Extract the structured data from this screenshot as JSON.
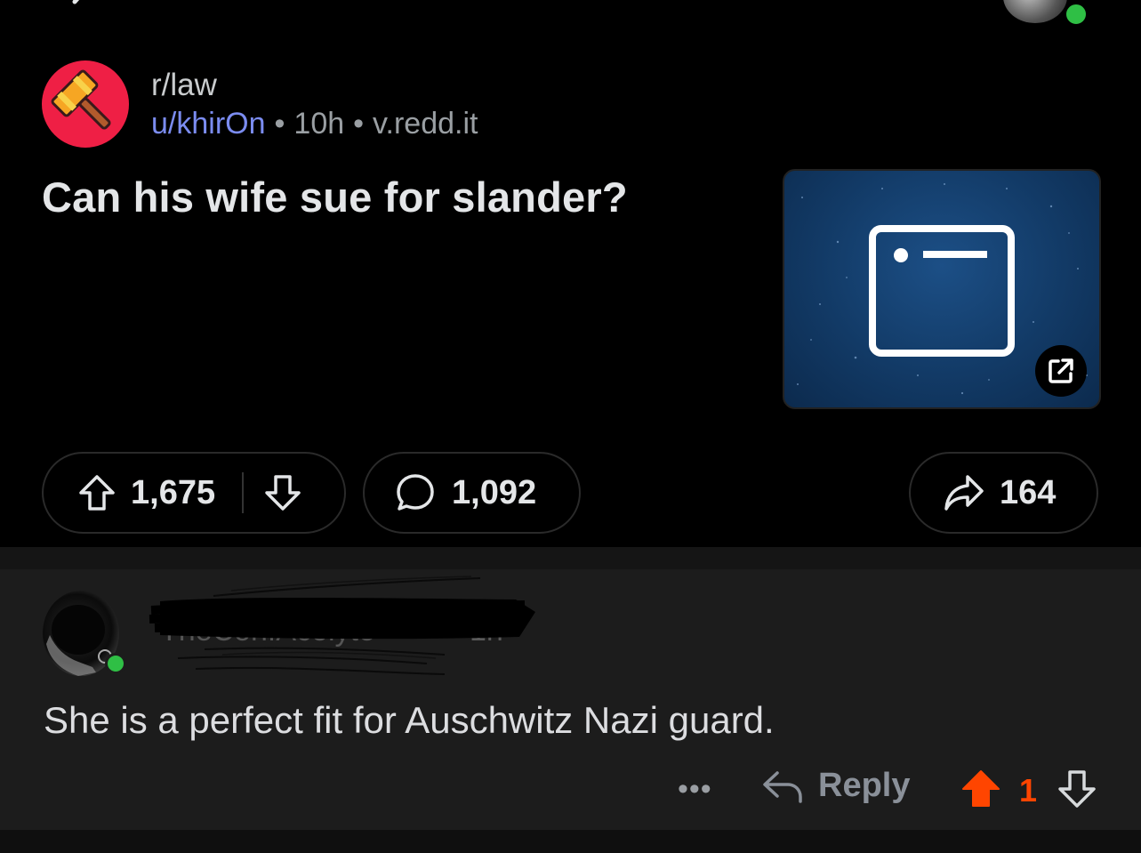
{
  "post": {
    "subreddit": "r/law",
    "author": "u/khirOn",
    "age": "10h",
    "domain": "v.redd.it",
    "title": "Can his wife sue for slander?",
    "upvotes": "1,675",
    "comments": "1,092",
    "shares": "164"
  },
  "comment": {
    "author": "TheConfAcolyte",
    "age": "1h",
    "body": "She is a perfect fit for Auschwitz Nazi guard.",
    "more_label": "•••",
    "reply_label": "Reply",
    "score": "1"
  },
  "icons": {
    "subreddit": "gavel-icon",
    "thumbnail": "browser-window-icon",
    "external": "external-link-icon",
    "upvote": "arrow-up-icon",
    "downvote": "arrow-down-icon",
    "comment": "speech-bubble-icon",
    "share": "share-arrow-icon",
    "reply": "reply-arrow-icon"
  },
  "colors": {
    "background": "#000000",
    "comment_background": "#1c1c1c",
    "subreddit_icon": "#ef1f45",
    "username": "#7b8cf0",
    "upvoted": "#ff4500",
    "online": "#2fbf45"
  }
}
